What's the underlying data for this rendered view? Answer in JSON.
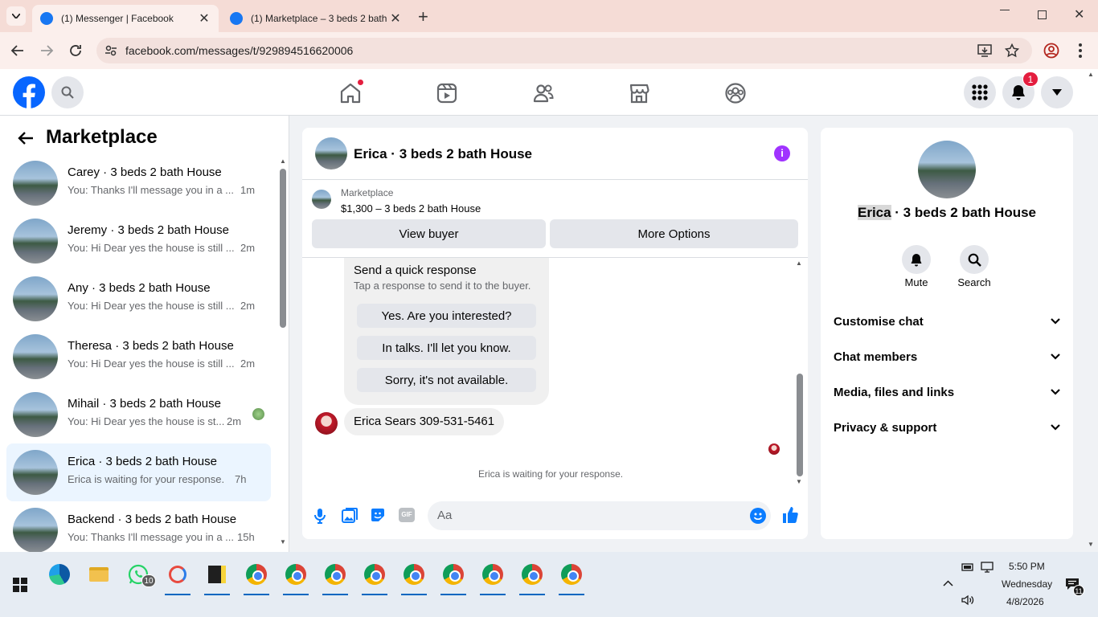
{
  "browser": {
    "tabs": [
      {
        "title": "(1) Messenger | Facebook",
        "active": true
      },
      {
        "title": "(1) Marketplace – 3 beds 2 bath",
        "active": false
      }
    ],
    "url": "facebook.com/messages/t/929894516620006"
  },
  "fb_header": {
    "notification_count": "1",
    "icons": [
      "facebook-logo-icon",
      "search-icon",
      "home-icon",
      "video-icon",
      "friends-icon",
      "marketplace-icon",
      "groups-icon",
      "menu-grid-icon",
      "bell-icon",
      "account-caret-icon"
    ]
  },
  "sidebar": {
    "title": "Marketplace",
    "conversations": [
      {
        "name": "Carey · 3 beds 2 bath House",
        "preview": "You: Thanks I'll message you in a ...",
        "time": "1m"
      },
      {
        "name": "Jeremy · 3 beds 2 bath House",
        "preview": "You: Hi Dear yes the house is still ...",
        "time": "2m"
      },
      {
        "name": "Any · 3 beds 2 bath House",
        "preview": "You: Hi Dear yes the house is still ...",
        "time": "2m"
      },
      {
        "name": "Theresa · 3 beds 2 bath House",
        "preview": "You: Hi Dear yes the house is still ...",
        "time": "2m"
      },
      {
        "name": "Mihail · 3 beds 2 bath House",
        "preview": "You: Hi Dear yes the house is st...",
        "time": "2m"
      },
      {
        "name": "Erica · 3 beds 2 bath House",
        "preview": "Erica is waiting for your response.",
        "time": "7h",
        "selected": true
      },
      {
        "name": "Backend · 3 beds 2 bath House",
        "preview": "You: Thanks I'll message you in a ...",
        "time": "15h"
      }
    ]
  },
  "chat": {
    "title": "Erica · 3 beds 2 bath House",
    "listing_label": "Marketplace",
    "listing_title": "$1,300 – 3 beds 2 bath House",
    "view_buyer": "View buyer",
    "more_options": "More Options",
    "quick_title": "Send a quick response",
    "quick_sub": "Tap a response to send it to the buyer.",
    "quick_responses": [
      "Yes. Are you interested?",
      "In talks. I'll let you know.",
      "Sorry, it's not available."
    ],
    "message": "Erica Sears 309-531-5461",
    "waiting": "Erica is waiting for your response.",
    "composer_placeholder": "Aa"
  },
  "info": {
    "name_highlight": "Erica",
    "name_rest": " · 3 beds 2 bath House",
    "mute": "Mute",
    "search": "Search",
    "sections": [
      "Customise chat",
      "Chat members",
      "Media, files and links",
      "Privacy & support"
    ]
  },
  "taskbar": {
    "time": "5:50 PM",
    "day": "Wednesday",
    "date": "4/8/2026",
    "whatsapp_badge": "10",
    "notif_badge": "11"
  }
}
